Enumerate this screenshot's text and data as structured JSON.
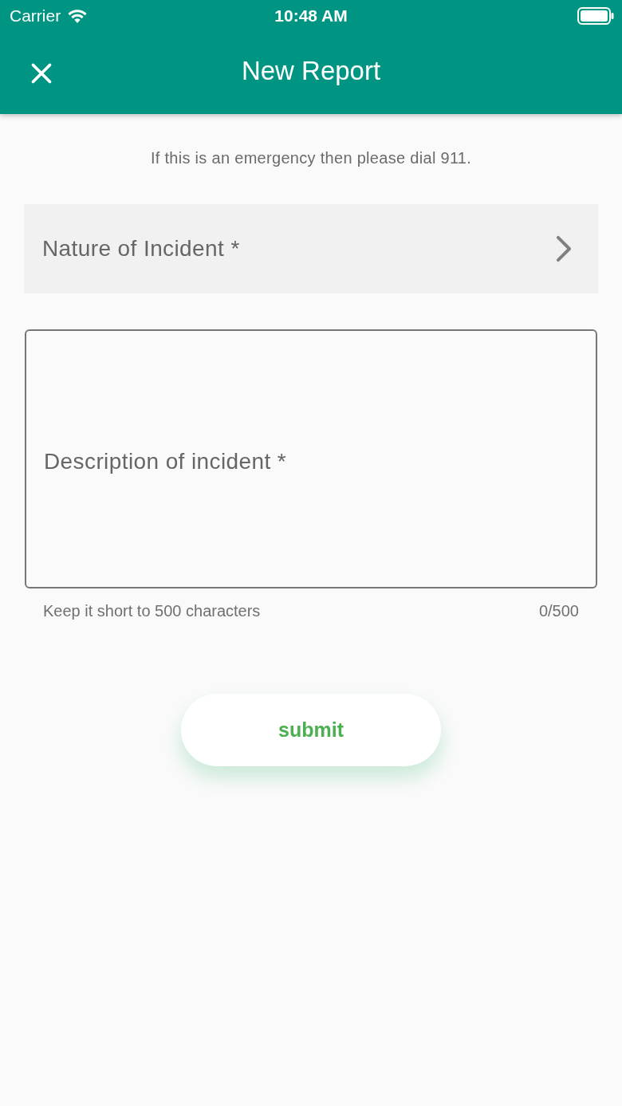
{
  "status_bar": {
    "carrier": "Carrier",
    "time": "10:48 AM"
  },
  "header": {
    "title": "New Report"
  },
  "notice": "If this is an emergency then please dial 911.",
  "incident_select": {
    "label": "Nature of Incident *"
  },
  "description": {
    "placeholder": "Description of incident *",
    "helper": "Keep it short to 500 characters",
    "counter": "0/500"
  },
  "submit": {
    "label": "submit"
  }
}
